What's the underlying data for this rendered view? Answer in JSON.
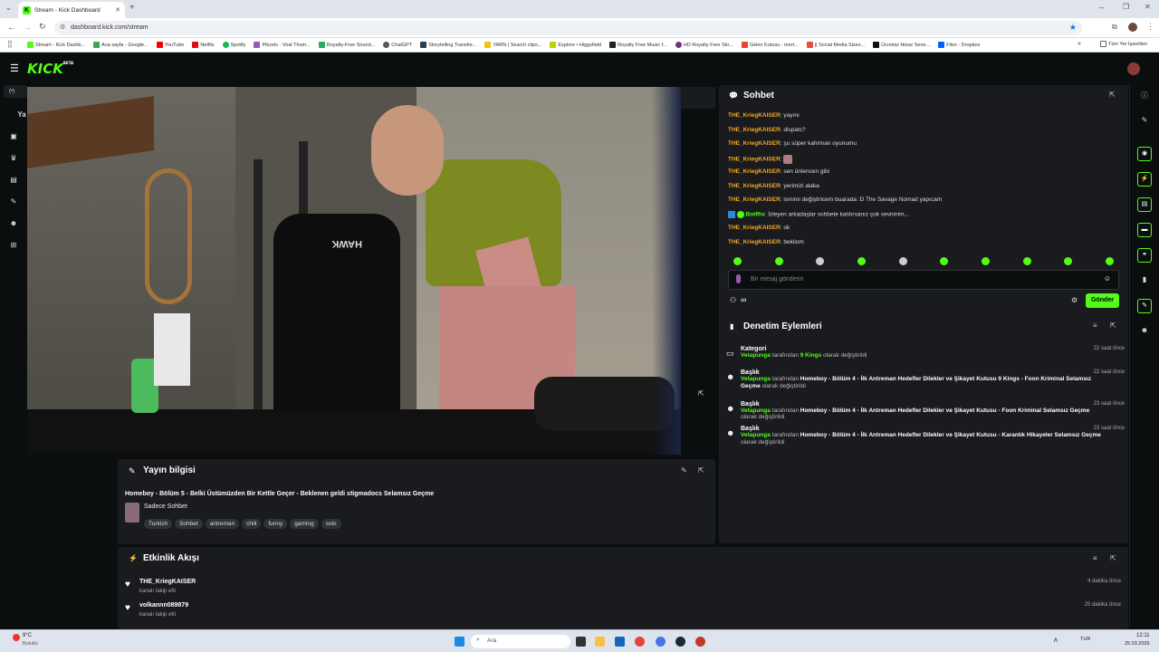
{
  "browser": {
    "tab_title": "Stream - Kick Dashboard",
    "url": "dashboard.kick.com/stream",
    "bookmarks": [
      "Stream - Kick Dashb...",
      "Ana sayfa - Google...",
      "YouTube",
      "Netflix",
      "Spotify",
      "Pikzels - Viral Thum...",
      "Royalty-Free Sound...",
      "ChatGPT",
      "Storytelling Transfor...",
      "YARN | Search clips...",
      "Explore • Higgsfield",
      "Royalty Free Music f...",
      "HD Royalty Free Sto...",
      "Gelen Kutusu - mert...",
      "|| Social Media Sizes...",
      "Ücretsiz Hisse Sene...",
      "Files - Dropbox"
    ],
    "all_bookmarks": "Tüm Yer İşaretleri"
  },
  "site": {
    "logo": "KICK",
    "logo_badge": "BETA",
    "left_label": "Ya"
  },
  "chat": {
    "title": "Sohbet",
    "messages": [
      {
        "user": "THE_KriegKAISER",
        "text": ": yayını"
      },
      {
        "user": "THE_KriegKAISER",
        "text": ": dispatc?"
      },
      {
        "user": "THE_KriegKAISER",
        "text": ": şu süper kahrman oyunumu"
      },
      {
        "user": "THE_KriegKAISER",
        "text": ":"
      },
      {
        "user": "THE_KriegKAISER",
        "text": ": sen ünlencen gibi"
      },
      {
        "user": "THE_KriegKAISER",
        "text": ": yerimizi alaka"
      },
      {
        "user": "THE_KriegKAISER",
        "text": ": ismimi değiştiricem buarada :D The Savage Nomad yapıcam"
      },
      {
        "user": "BotRix",
        "text": ": İzleyen arkadaşlar sohbete katılırsanız çok sevinirim..."
      },
      {
        "user": "THE_KriegKAISER",
        "text": ": ok"
      },
      {
        "user": "THE_KriegKAISER",
        "text": ": bekliom"
      }
    ],
    "placeholder": "Bir mesaj gönderin",
    "send": "Gönder",
    "viewer_count": "∞"
  },
  "moderation": {
    "title": "Denetim Eylemleri",
    "items": [
      {
        "type": "Kategori",
        "actor": "Vetapunga",
        "mid": " tarafından ",
        "bold": "9 Kings",
        "suffix": " olarak değiştirildi",
        "time": "22 saat önce"
      },
      {
        "type": "Başlık",
        "actor": "Vetapunga",
        "mid": " tarafından ",
        "bold": "Homeboy - Bölüm 4 - İlk Antreman Hedefler Dilekler ve Şikayet Kutusu 9 Kings - Foon Kriminal Selamsız Geçme",
        "suffix": " olarak değiştirildi",
        "time": "22 saat önce"
      },
      {
        "type": "Başlık",
        "actor": "Vetapunga",
        "mid": " tarafından ",
        "bold": "Homeboy - Bölüm 4 - İlk Antreman Hedefler Dilekler ve Şikayet Kutusu - Foon Kriminal Selamsız Geçme",
        "suffix": " olarak değiştirildi",
        "time": "23 saat önce"
      },
      {
        "type": "Başlık",
        "actor": "Vetapunga",
        "mid": " tarafından ",
        "bold": "Homeboy - Bölüm 4 - İlk Antreman Hedefler Dilekler ve Şikayet Kutusu - Karanlık Hikayeler Selamsız Geçme",
        "suffix": " olarak değiştirildi",
        "time": "23 saat önce"
      }
    ]
  },
  "stream_info": {
    "title": "Yayın bilgisi",
    "stream_title": "Homeboy - Bölüm 5 - Belki Üstümüzden Bir Kettle Geçer - Beklenen geldi stigmadocs Selamsız Geçme",
    "category": "Sadece Sohbet",
    "tags": [
      "Turkish",
      "Sohbet",
      "antreman",
      "chill",
      "funny",
      "gaming",
      "solo"
    ]
  },
  "activity": {
    "title": "Etkinlik Akışı",
    "items": [
      {
        "user": "THE_KriegKAISER",
        "action": "kanalı takip etti",
        "time": "4 dakika önce"
      },
      {
        "user": "volkannn089879",
        "action": "kanalı takip etti",
        "time": "25 dakika önce"
      }
    ]
  },
  "taskbar": {
    "weather_temp": "9°C",
    "weather_desc": "Bulutlu",
    "search": "Ara",
    "lang": "TUR",
    "time": "12:11",
    "date": "25.03.2026"
  },
  "colors": {
    "accent": "#53fc18",
    "username": "#f5a623",
    "bg": "#0b0e0f",
    "card": "#191b1f"
  }
}
